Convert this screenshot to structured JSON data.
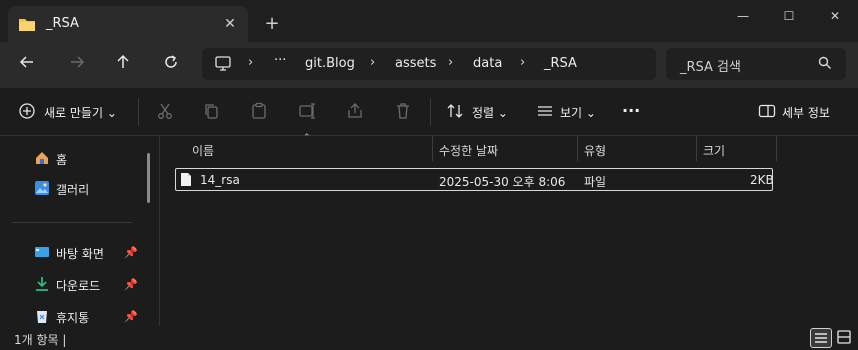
{
  "window": {
    "tab_title": "_RSA",
    "close_glyph": "✕",
    "new_tab_glyph": "+",
    "minimize_glyph": "—",
    "maximize_glyph": "☐",
    "close_window_glyph": "✕"
  },
  "address": {
    "more_glyph": "···",
    "crumbs": [
      "git.Blog",
      "assets",
      "data",
      "_RSA"
    ],
    "separator": "›"
  },
  "search": {
    "placeholder": "_RSA 검색"
  },
  "toolbar": {
    "new_label": "새로 만들기",
    "sort_label": "정렬",
    "view_label": "보기",
    "more_label": "···",
    "details_label": "세부 정보"
  },
  "sidebar": {
    "items": [
      {
        "label": "홈",
        "icon": "home-icon"
      },
      {
        "label": "갤러리",
        "icon": "gallery-icon"
      },
      {
        "label": "바탕 화면",
        "icon": "desktop-icon"
      },
      {
        "label": "다운로드",
        "icon": "download-icon"
      },
      {
        "label": "휴지통",
        "icon": "recycle-bin-icon"
      }
    ]
  },
  "columns": {
    "name": "이름",
    "modified": "수정한 날짜",
    "type": "유형",
    "size": "크기"
  },
  "files": [
    {
      "name": "14_rsa",
      "modified": "2025-05-30 오후 8:06",
      "type": "파일",
      "size": "2KB"
    }
  ],
  "status": {
    "text": "1개 항목 |"
  },
  "colors": {
    "accent": "#4cc2ff",
    "folder": "#f4c542",
    "background": "#1c1c1c"
  }
}
